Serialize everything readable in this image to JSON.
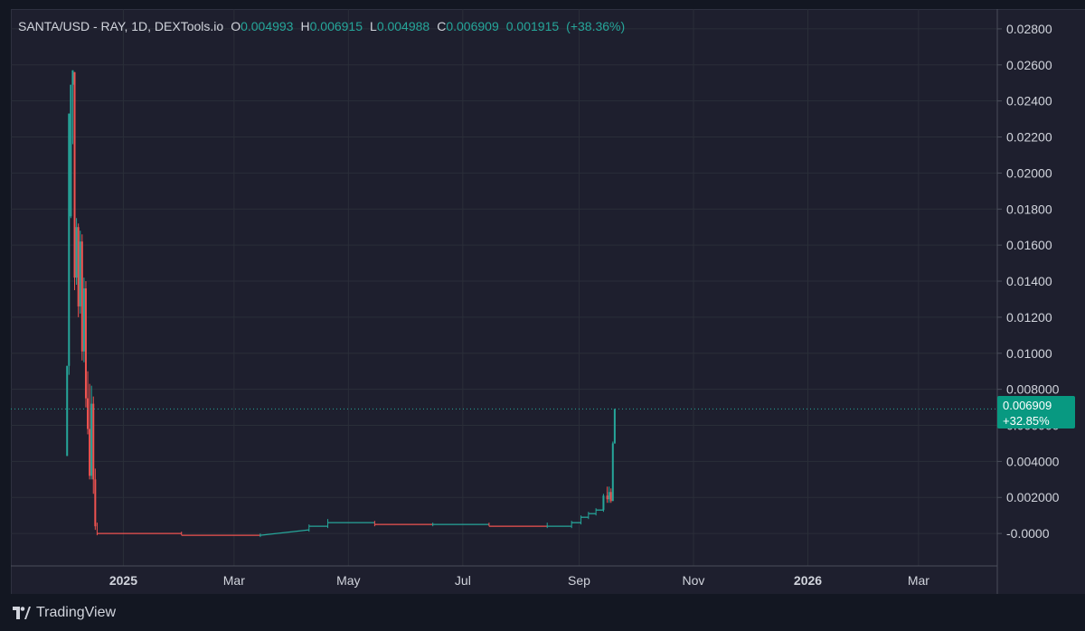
{
  "header": {
    "symbol": "SANTA/USD - RAY, 1D, DEXTools.io",
    "o_label": "O",
    "o_value": "0.004993",
    "h_label": "H",
    "h_value": "0.006915",
    "l_label": "L",
    "l_value": "0.004988",
    "c_label": "C",
    "c_value": "0.006909",
    "change": "0.001915",
    "change_pct": "(+38.36%)"
  },
  "price_tag": {
    "price": "0.006909",
    "change": "+32.85%"
  },
  "footer": {
    "brand": "TradingView"
  },
  "colors": {
    "up": "#26a69a",
    "down": "#ef5350",
    "background": "#1e1f2e",
    "grid": "#2a2e39",
    "text": "#d1d4dc",
    "tag": "#089981"
  },
  "chart_data": {
    "type": "candlestick",
    "title": "SANTA/USD - RAY, 1D, DEXTools.io",
    "x_ticks": [
      "2025",
      "Mar",
      "May",
      "Jul",
      "Sep",
      "Nov",
      "2026",
      "Mar"
    ],
    "x_tick_dates": [
      "2025-01-01",
      "2025-03-01",
      "2025-05-01",
      "2025-07-01",
      "2025-09-01",
      "2025-11-01",
      "2026-01-01",
      "2026-03-01"
    ],
    "x_range": [
      "2024-11-02",
      "2026-04-12"
    ],
    "y_ticks": [
      "0.02800",
      "0.02600",
      "0.02400",
      "0.02200",
      "0.02000",
      "0.01800",
      "0.01600",
      "0.01400",
      "0.01200",
      "0.01000",
      "0.008000",
      "0.006000",
      "0.004000",
      "0.002000",
      "-0.0000"
    ],
    "y_range": [
      -0.0018,
      0.0291
    ],
    "last_price": 0.006909,
    "grid": true,
    "series": [
      {
        "ohlc": [
          [
            "2024-12-02",
            0.0043,
            0.0093,
            0.0043,
            0.0093
          ],
          [
            "2024-12-03",
            0.0093,
            0.0233,
            0.0088,
            0.0233
          ],
          [
            "2024-12-04",
            0.0176,
            0.0249,
            0.0175,
            0.0249
          ],
          [
            "2024-12-05",
            0.0249,
            0.0257,
            0.0216,
            0.0257
          ],
          [
            "2024-12-06",
            0.0256,
            0.0256,
            0.0135,
            0.0142
          ],
          [
            "2024-12-07",
            0.0142,
            0.0175,
            0.0138,
            0.017
          ],
          [
            "2024-12-08",
            0.017,
            0.0172,
            0.012,
            0.0126
          ],
          [
            "2024-12-09",
            0.0126,
            0.0168,
            0.0122,
            0.0162
          ],
          [
            "2024-12-10",
            0.0162,
            0.0166,
            0.0096,
            0.0101
          ],
          [
            "2024-12-11",
            0.0101,
            0.0142,
            0.0095,
            0.0136
          ],
          [
            "2024-12-12",
            0.0136,
            0.014,
            0.007,
            0.0075
          ],
          [
            "2024-12-13",
            0.0075,
            0.009,
            0.0055,
            0.0058
          ],
          [
            "2024-12-14",
            0.0058,
            0.0083,
            0.003,
            0.0032
          ],
          [
            "2024-12-15",
            0.0032,
            0.0082,
            0.003,
            0.0072
          ],
          [
            "2024-12-16",
            0.0072,
            0.0076,
            0.0022,
            0.003
          ],
          [
            "2024-12-17",
            0.003,
            0.0036,
            0.0002,
            0.0004
          ],
          [
            "2024-12-18",
            0.0004,
            0.0006,
            -0.0001,
            0.0
          ],
          [
            "2025-02-01",
            0.0,
            0.0001,
            -0.0001,
            -0.0001
          ],
          [
            "2025-03-15",
            -0.0001,
            0.0,
            -0.0002,
            -0.0001
          ],
          [
            "2025-04-10",
            0.0002,
            0.0005,
            0.0001,
            0.0004
          ],
          [
            "2025-04-20",
            0.0004,
            0.0008,
            0.0003,
            0.0006
          ],
          [
            "2025-05-15",
            0.0006,
            0.0007,
            0.0004,
            0.0005
          ],
          [
            "2025-06-15",
            0.0005,
            0.0006,
            0.0004,
            0.0005
          ],
          [
            "2025-07-15",
            0.0005,
            0.0006,
            0.0004,
            0.0004
          ],
          [
            "2025-08-15",
            0.0004,
            0.0006,
            0.0003,
            0.0004
          ],
          [
            "2025-08-28",
            0.0004,
            0.0007,
            0.0003,
            0.0006
          ],
          [
            "2025-09-02",
            0.0006,
            0.001,
            0.0005,
            0.0009
          ],
          [
            "2025-09-06",
            0.0009,
            0.0012,
            0.0008,
            0.0011
          ],
          [
            "2025-09-10",
            0.0011,
            0.0014,
            0.001,
            0.0013
          ],
          [
            "2025-09-14",
            0.0013,
            0.0022,
            0.0012,
            0.0021
          ],
          [
            "2025-09-16",
            0.0021,
            0.0026,
            0.0017,
            0.0019
          ],
          [
            "2025-09-17",
            0.0019,
            0.0026,
            0.0017,
            0.0023
          ],
          [
            "2025-09-18",
            0.0023,
            0.0025,
            0.0017,
            0.0018
          ],
          [
            "2025-09-19",
            0.0018,
            0.0051,
            0.0018,
            0.005
          ],
          [
            "2025-09-20",
            0.004993,
            0.006915,
            0.004988,
            0.006909
          ]
        ]
      }
    ]
  }
}
